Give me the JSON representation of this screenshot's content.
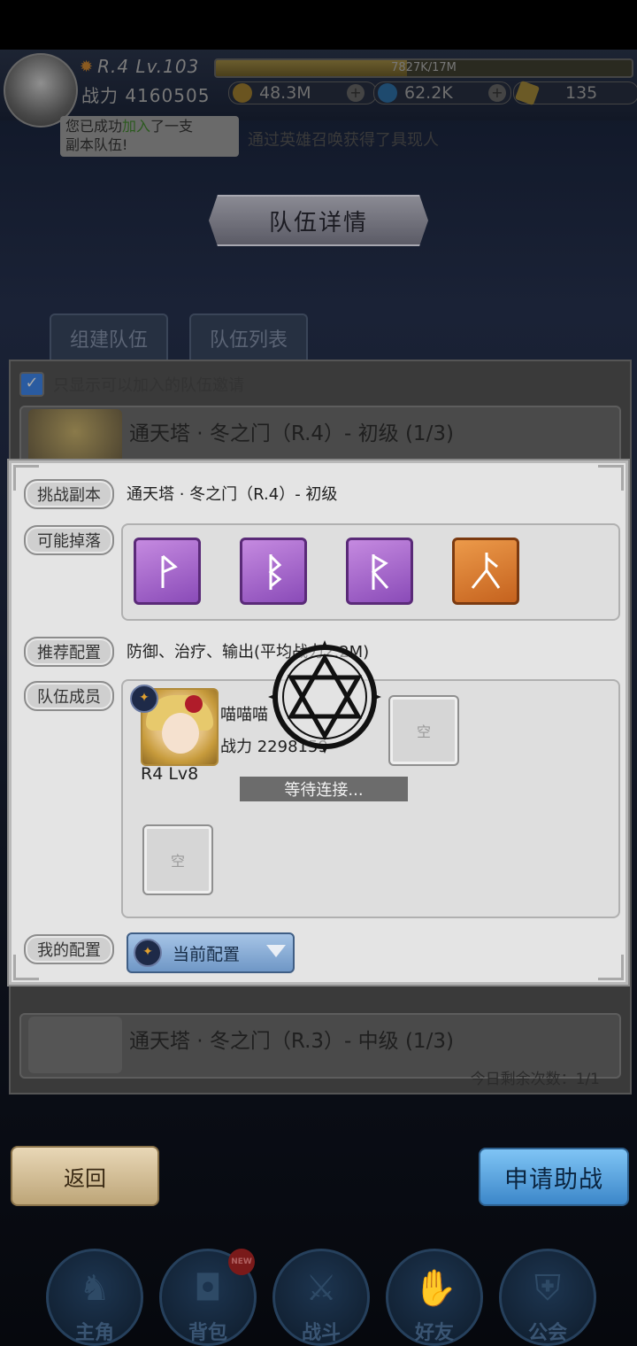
{
  "hud": {
    "rank": "R.4 Lv.103",
    "exp_text": "7827K/17M",
    "exp_fraction": 0.46,
    "power": "战力 4160505",
    "gold": "48.3M",
    "gems": "62.2K",
    "crystals": "135"
  },
  "toast": {
    "line1_a": "您已成功",
    "line1_hl": "加入",
    "line1_b": "了一支",
    "line2": "副本队伍!"
  },
  "marquee": "通过英雄召唤获得了具现人",
  "page_title": "队伍详情",
  "tabs": [
    "组建队伍",
    "队伍列表"
  ],
  "filter_label": "只显示可以加入的队伍邀请",
  "list": {
    "items": [
      {
        "title": "通天塔 · 冬之门（R.4）-  初级 (1/3)"
      },
      {
        "title": "通天塔 · 冬之门（R.3）-  中级 (1/3)"
      }
    ],
    "remaining": "今日剩余次数：1/1"
  },
  "dialog": {
    "challenge_tag": "挑战副本",
    "challenge_value": "通天塔 · 冬之门（R.4）- 初级",
    "drops_tag": "可能掉落",
    "drops": [
      {
        "icon": "purple-rune-icon"
      },
      {
        "icon": "purple-rune-icon"
      },
      {
        "icon": "purple-rune-icon"
      },
      {
        "icon": "orange-rune-icon"
      }
    ],
    "recommend_tag": "推荐配置",
    "recommend_value": "防御、治疗、输出(平均战力2.2M)",
    "members_tag": "队伍成员",
    "member": {
      "name": "喵喵喵",
      "power": "战力 2298159",
      "rank": "R4  Lv8"
    },
    "empty_slot": "空",
    "waiting": "等待连接...",
    "config_tag": "我的配置",
    "config_value": "当前配置"
  },
  "buttons": {
    "back": "返回",
    "apply": "申请助战"
  },
  "nav": {
    "items": [
      "主角",
      "背包",
      "战斗",
      "好友",
      "公会"
    ],
    "new_badge": "NEW"
  },
  "colors": {
    "dialog_bg": "#e4e4e4",
    "purple_rune": "#a264cf",
    "orange_rune": "#e2853a",
    "apply_blue": "#4f9ad8",
    "back_tan": "#d8c39a"
  }
}
